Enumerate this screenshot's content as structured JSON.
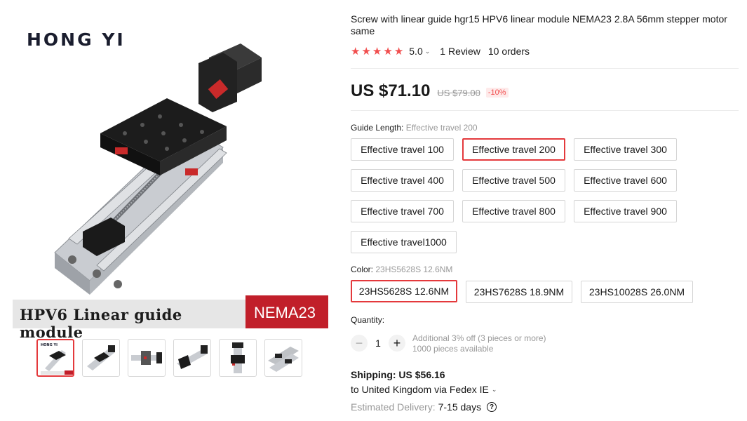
{
  "gallery": {
    "brand": "HONG YI",
    "banner_left": "HPV6 Linear guide module",
    "banner_right": "NEMA23",
    "thumbnails": [
      "thumb-1",
      "thumb-2",
      "thumb-3",
      "thumb-4",
      "thumb-5",
      "thumb-6"
    ],
    "active_thumbnail": 0
  },
  "product": {
    "title": "Screw with linear guide hgr15 HPV6 linear module NEMA23 2.8A 56mm stepper motor same",
    "rating": "5.0",
    "stars": 5,
    "reviews": "1 Review",
    "orders": "10 orders",
    "price": "US $71.10",
    "old_price": "US $79.00",
    "discount": "-10%"
  },
  "guide_length": {
    "label": "Guide Length:",
    "selected": "Effective travel 200",
    "options": [
      "Effective travel 100",
      "Effective travel 200",
      "Effective travel 300",
      "Effective travel 400",
      "Effective travel 500",
      "Effective travel 600",
      "Effective travel 700",
      "Effective travel 800",
      "Effective travel 900",
      "Effective travel1000"
    ]
  },
  "color": {
    "label": "Color:",
    "selected": "23HS5628S 12.6NM",
    "options": [
      "23HS5628S 12.6NM",
      "23HS7628S 18.9NM",
      "23HS10028S 26.0NM"
    ]
  },
  "quantity": {
    "label": "Quantity:",
    "value": "1",
    "minus": "−",
    "plus": "+",
    "note_discount": "Additional 3% off (3 pieces or more)",
    "note_available": "1000 pieces available"
  },
  "shipping": {
    "cost": "Shipping: US $56.16",
    "destination": "to United Kingdom via Fedex IE",
    "delivery_label": "Estimated Delivery:",
    "delivery_days": "7-15 days",
    "help": "?"
  },
  "colors": {
    "accent_red": "#e4393c",
    "star": "#f14e4e",
    "banner_red": "#c11f2a"
  }
}
